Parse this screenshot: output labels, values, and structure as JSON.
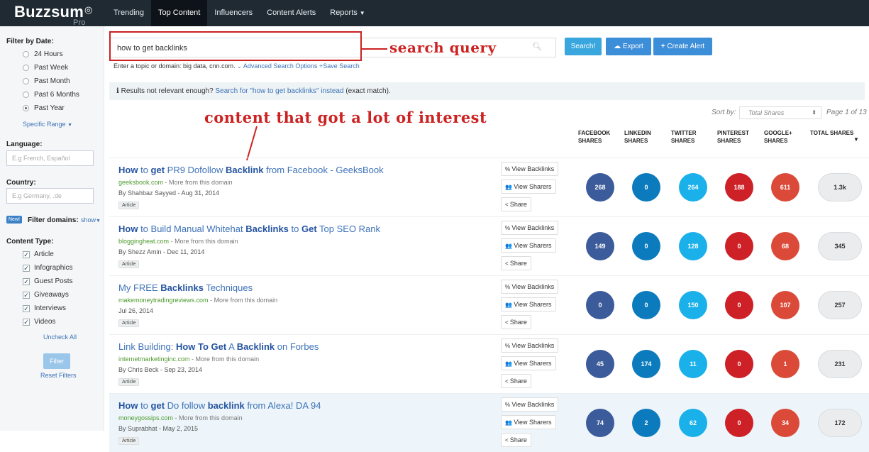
{
  "app": {
    "logo": "Buzzsum",
    "logo_pro": "Pro"
  },
  "nav": [
    "Trending",
    "Top Content",
    "Influencers",
    "Content Alerts",
    "Reports"
  ],
  "sidebar": {
    "date_heading": "Filter by Date:",
    "dates": [
      "24 Hours",
      "Past Week",
      "Past Month",
      "Past 6 Months",
      "Past Year"
    ],
    "selected_date": "Past Year",
    "specific_range": "Specific Range",
    "language_heading": "Language:",
    "language_placeholder": "E.g French, Español",
    "country_heading": "Country:",
    "country_placeholder": "E.g Germany, .de",
    "new_badge": "New!",
    "filter_domains": "Filter domains:",
    "show": "show",
    "content_type_heading": "Content Type:",
    "content_types": [
      "Article",
      "Infographics",
      "Guest Posts",
      "Giveaways",
      "Interviews",
      "Videos"
    ],
    "uncheck_all": "Uncheck All",
    "filter_button": "Filter",
    "reset_filters": "Reset Filters"
  },
  "search": {
    "value": "how to get backlinks",
    "search_button": "Search!",
    "export_button": "Export",
    "alert_button": "Create Alert",
    "hint_text": "Enter a topic or domain: big data, cnn.com.",
    "advanced_options": "Advanced Search Options",
    "save_search": "Save Search"
  },
  "annotations": {
    "search_query": "search query",
    "content_interest": "content that got a lot of interest"
  },
  "info": {
    "lead": "Results not relevant enough?",
    "link": "Search for \"how to get backlinks\" instead",
    "tail": "(exact match)."
  },
  "sort": {
    "label": "Sort by:",
    "selected": "Total Shares",
    "page": "Page 1 of 13"
  },
  "columns": [
    {
      "l1": "FACEBOOK",
      "l2": "SHARES"
    },
    {
      "l1": "LINKEDIN",
      "l2": "SHARES"
    },
    {
      "l1": "TWITTER",
      "l2": "SHARES"
    },
    {
      "l1": "PINTEREST",
      "l2": "SHARES"
    },
    {
      "l1": "GOOGLE+",
      "l2": "SHARES"
    },
    {
      "l1": "TOTAL SHARES",
      "l2": ""
    }
  ],
  "actions": {
    "view_backlinks": "View Backlinks",
    "view_sharers": "View Sharers",
    "share": "Share"
  },
  "colors": {
    "facebook": "#3b5b9a",
    "linkedin": "#0b7bbd",
    "twitter": "#1ab0ea",
    "pinterest": "#cd2027",
    "google": "#db4a39",
    "total": "#eaecee"
  },
  "results": [
    {
      "title_parts": [
        [
          "b",
          "How"
        ],
        [
          "t",
          " to "
        ],
        [
          "b",
          "get"
        ],
        [
          "t",
          " PR9 Dofollow "
        ],
        [
          "b",
          "Backlink"
        ],
        [
          "t",
          " from Facebook - GeeksBook"
        ]
      ],
      "domain": "geeksbook.com",
      "more": "More from this domain",
      "byline": "By Shahbaz Sayyed - Aug 31, 2014",
      "type": "Article",
      "facebook": "268",
      "linkedin": "0",
      "twitter": "264",
      "pinterest": "188",
      "google": "611",
      "total": "1.3k"
    },
    {
      "title_parts": [
        [
          "b",
          "How"
        ],
        [
          "t",
          " to Build Manual Whitehat "
        ],
        [
          "b",
          "Backlinks"
        ],
        [
          "t",
          " to "
        ],
        [
          "b",
          "Get"
        ],
        [
          "t",
          " Top SEO Rank"
        ]
      ],
      "domain": "bloggingheat.com",
      "more": "More from this domain",
      "byline": "By Shezz Amin - Dec 11, 2014",
      "type": "Article",
      "facebook": "149",
      "linkedin": "0",
      "twitter": "128",
      "pinterest": "0",
      "google": "68",
      "total": "345"
    },
    {
      "title_parts": [
        [
          "t",
          "My FREE "
        ],
        [
          "b",
          "Backlinks"
        ],
        [
          "t",
          " Techniques"
        ]
      ],
      "domain": "makemoneytradingreviews.com",
      "more": "More from this domain",
      "byline": "Jul 26, 2014",
      "type": "Article",
      "facebook": "0",
      "linkedin": "0",
      "twitter": "150",
      "pinterest": "0",
      "google": "107",
      "total": "257"
    },
    {
      "title_parts": [
        [
          "t",
          "Link Building: "
        ],
        [
          "b",
          "How To Get"
        ],
        [
          "t",
          " A "
        ],
        [
          "b",
          "Backlink"
        ],
        [
          "t",
          " on Forbes"
        ]
      ],
      "domain": "internetmarketinginc.com",
      "more": "More from this domain",
      "byline": "By Chris Beck - Sep 23, 2014",
      "type": "Article",
      "facebook": "45",
      "linkedin": "174",
      "twitter": "11",
      "pinterest": "0",
      "google": "1",
      "total": "231"
    },
    {
      "title_parts": [
        [
          "b",
          "How"
        ],
        [
          "t",
          " to "
        ],
        [
          "b",
          "get"
        ],
        [
          "t",
          " Do follow "
        ],
        [
          "b",
          "backlink"
        ],
        [
          "t",
          " from Alexa! DA 94"
        ]
      ],
      "domain": "moneygossips.com",
      "more": "More from this domain",
      "byline": "By Suprabhat - May 2, 2015",
      "type": "Article",
      "facebook": "74",
      "linkedin": "2",
      "twitter": "62",
      "pinterest": "0",
      "google": "34",
      "total": "172"
    }
  ]
}
